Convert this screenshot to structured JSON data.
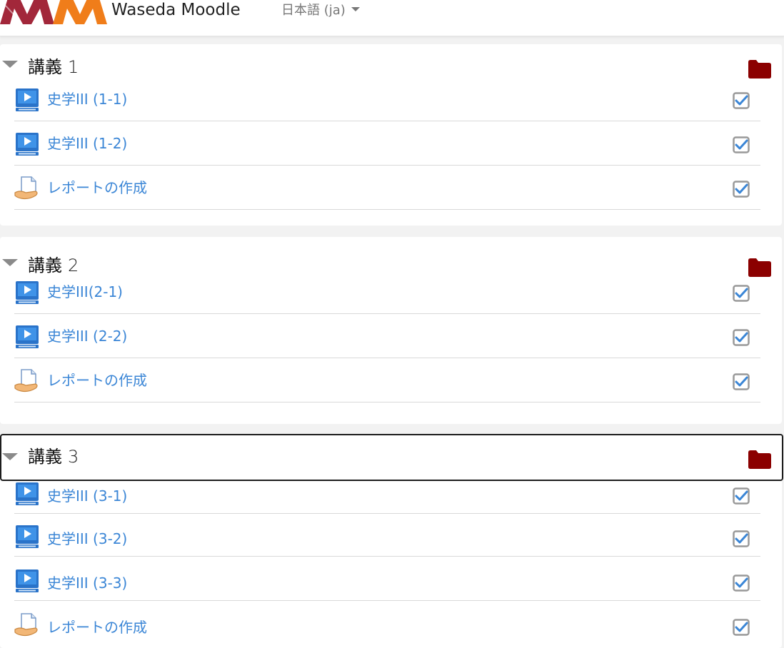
{
  "header": {
    "site_name": "Waseda Moodle",
    "language": "日本語 (ja)"
  },
  "colors": {
    "link": "#3b86d6",
    "folder": "#8b0000",
    "logo_primary": "#a2273a",
    "logo_secondary": "#f07d1a"
  },
  "sections": [
    {
      "title": "講義",
      "number": "1",
      "activities": [
        {
          "type": "video",
          "icon": "video-icon",
          "name": "史学III (1-1)"
        },
        {
          "type": "video",
          "icon": "video-icon",
          "name": "史学III (1-2)"
        },
        {
          "type": "assignment",
          "icon": "assignment-icon",
          "name": "レポートの作成"
        }
      ]
    },
    {
      "title": "講義",
      "number": "2",
      "activities": [
        {
          "type": "video",
          "icon": "video-icon",
          "name": "史学III(2-1)"
        },
        {
          "type": "video",
          "icon": "video-icon",
          "name": "史学III (2-2)"
        },
        {
          "type": "assignment",
          "icon": "assignment-icon",
          "name": "レポートの作成"
        }
      ]
    },
    {
      "title": "講義",
      "number": "3",
      "activities": [
        {
          "type": "video",
          "icon": "video-icon",
          "name": "史学III (3-1)"
        },
        {
          "type": "video",
          "icon": "video-icon",
          "name": "史学III (3-2)"
        },
        {
          "type": "video",
          "icon": "video-icon",
          "name": "史学III (3-3)"
        },
        {
          "type": "assignment",
          "icon": "assignment-icon",
          "name": "レポートの作成"
        }
      ]
    }
  ]
}
